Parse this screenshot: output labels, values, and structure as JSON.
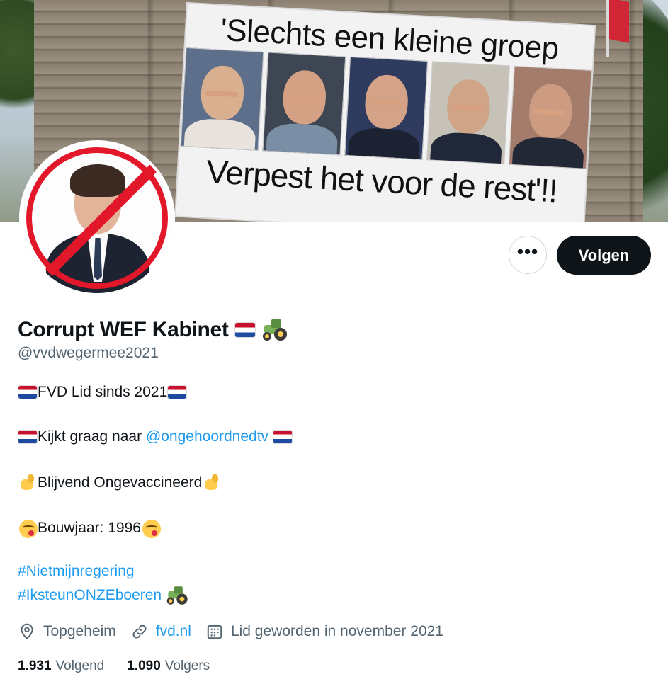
{
  "banner": {
    "poster_top_text": "'Slechts een kleine groep",
    "poster_bottom_text": "Verpest het voor de rest'!!"
  },
  "actions": {
    "more_label": "•••",
    "follow_label": "Volgen"
  },
  "profile": {
    "name": "Corrupt WEF Kabinet",
    "handle": "@vvdwegermee2021",
    "bio": {
      "line1": "FVD Lid sinds 2021",
      "line2_text": "Kijkt graag naar",
      "line2_link": "@ongehoordnedtv",
      "line3": "Blijvend Ongevaccineerd",
      "line4": "Bouwjaar: 1996",
      "hashtag1": "#Nietmijnregering",
      "hashtag2": "#IksteunONZEboeren"
    },
    "location": "Topgeheim",
    "website": "fvd.nl",
    "joined": "Lid geworden in november 2021",
    "following_count": "1.931",
    "following_label": "Volgend",
    "followers_count": "1.090",
    "followers_label": "Volgers"
  },
  "colors": {
    "link": "#1d9bf0",
    "secondary_text": "#536471",
    "follow_button_bg": "#0f1419",
    "ban_red": "#e3172a"
  },
  "icons": [
    "netherlands-flag-icon",
    "tractor-icon",
    "flexed-biceps-icon",
    "yum-face-icon",
    "location-pin-icon",
    "link-icon",
    "calendar-icon",
    "more-dots-icon"
  ]
}
